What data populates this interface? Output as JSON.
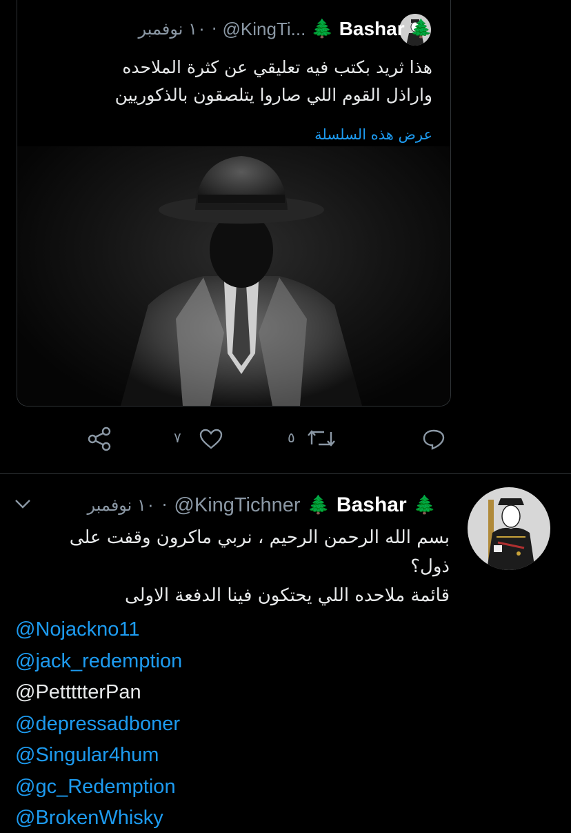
{
  "quoted_tweet": {
    "author_name": "Bashar",
    "author_emoji": "🌲",
    "handle": "@KingTi...",
    "date": "١٠ نوفمبر",
    "separator": "·",
    "text_line1": "هذا ثريد بكتب فيه تعليقي عن كثرة الملاحده",
    "text_line2": "واراذل القوم اللي صاروا يتلصقون بالذكوريين",
    "show_thread": "عرض هذه السلسلة",
    "media_icon": "man-in-fedora-photo"
  },
  "actions": {
    "reply_count": "",
    "retweet_count": "٥",
    "like_count": "٧",
    "share_count": ""
  },
  "tweet": {
    "author_name": "Bashar",
    "author_emoji": "🌲",
    "handle": "@KingTichner",
    "date": "١٠ نوفمبر",
    "separator": "·",
    "text_line1": "بسم الله الرحمن الرحيم ، نربي ماكرون وقفت على",
    "text_line2": "ذول؟",
    "text_line3": "قائمة ملاحده اللي يحتكون فينا الدفعة الاولى",
    "mentions": [
      {
        "text": "@Nojackno11",
        "color": "#1d9bf0"
      },
      {
        "text": "@jack_redemption",
        "color": "#1d9bf0"
      },
      {
        "text": "@PettttterPan",
        "color": "#e7e9ea"
      },
      {
        "text": "@depressadboner",
        "color": "#1d9bf0"
      },
      {
        "text": "@Singular4hum",
        "color": "#1d9bf0"
      },
      {
        "text": "@gc_Redemption",
        "color": "#1d9bf0"
      },
      {
        "text": "@BrokenWhisky",
        "color": "#1d9bf0"
      }
    ]
  },
  "colors": {
    "background": "#000000",
    "link": "#1d9bf0",
    "secondary_text": "#8b98a5",
    "divider": "#2f3336"
  }
}
